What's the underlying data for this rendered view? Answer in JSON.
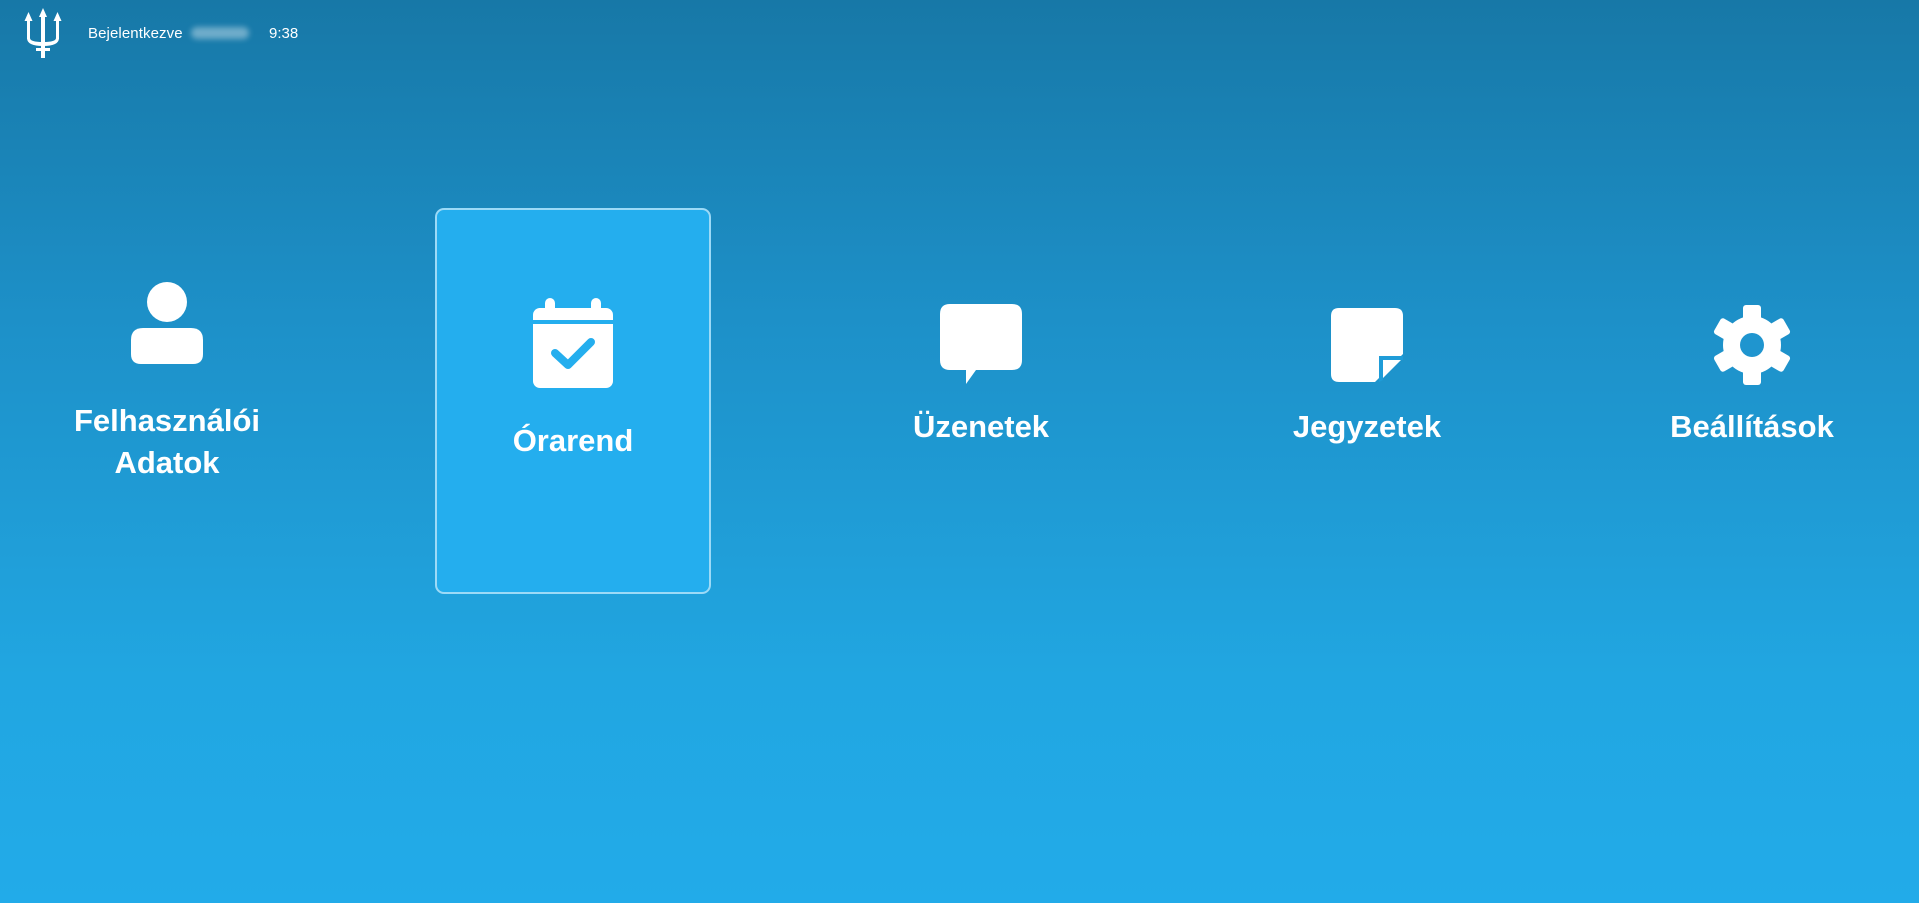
{
  "header": {
    "logo_icon": "trident-icon",
    "logged_in_label": "Bejelentkezve",
    "time": "9:38"
  },
  "menu": {
    "selected": "Órarend",
    "tiles": [
      {
        "label_line1": "Felhasználói",
        "label_line2": "Adatok",
        "icon": "user-icon"
      },
      {
        "label": "Órarend",
        "icon": "calendar-check-icon"
      },
      {
        "label": "Üzenetek",
        "icon": "chat-bubble-icon"
      },
      {
        "label": "Jegyzetek",
        "icon": "sticky-note-icon"
      },
      {
        "label": "Beállítások",
        "icon": "gear-icon"
      }
    ]
  },
  "colors": {
    "background_top": "#1778a7",
    "background_bottom": "#22abe9",
    "selected_tile": "#24aeee",
    "icon": "#ffffff"
  }
}
